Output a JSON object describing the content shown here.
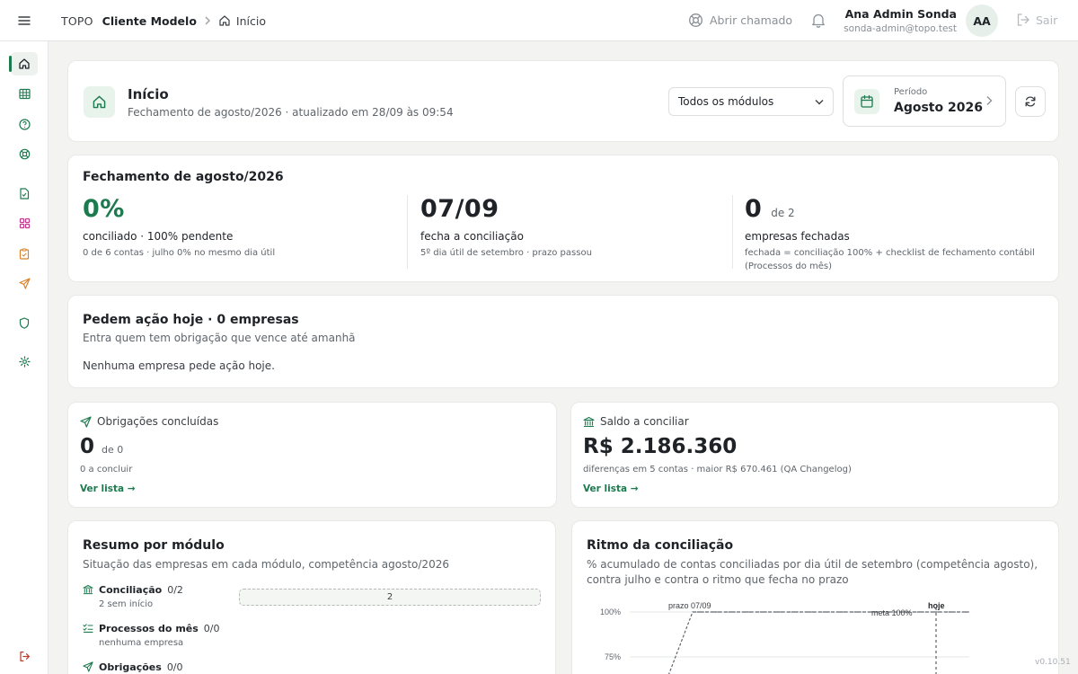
{
  "topbar": {
    "brand": "TOPO",
    "client": "Cliente Modelo",
    "breadcrumb_current": "Início",
    "open_ticket": "Abrir chamado",
    "user_name": "Ana Admin Sonda",
    "user_email": "sonda-admin@topo.test",
    "avatar_initials": "AA",
    "logout": "Sair"
  },
  "sidebar": {
    "items": [
      {
        "icon": "home-icon",
        "active": true
      },
      {
        "icon": "table-icon"
      },
      {
        "icon": "help-icon"
      },
      {
        "icon": "lifebuoy-icon"
      },
      {
        "icon": "document-icon"
      },
      {
        "icon": "apps-icon"
      },
      {
        "icon": "clipboard-icon"
      },
      {
        "icon": "send-icon"
      },
      {
        "icon": "shield-icon"
      },
      {
        "icon": "settings-icon"
      },
      {
        "icon": "logout-icon"
      }
    ]
  },
  "header": {
    "title": "Início",
    "subtitle": "Fechamento de agosto/2026 · atualizado em 28/09 às 09:54",
    "module_select": "Todos os módulos",
    "period_label": "Período",
    "period_value": "Agosto 2026"
  },
  "closing": {
    "title": "Fechamento de agosto/2026",
    "kpis": [
      {
        "big": "0%",
        "small": "",
        "label": "conciliado · 100% pendente",
        "sub": "0 de 6 contas · julho 0% no mesmo dia útil"
      },
      {
        "big": "07/09",
        "small": "",
        "label": "fecha a conciliação",
        "sub": "5º dia útil de setembro · prazo passou"
      },
      {
        "big": "0",
        "small": "de 2",
        "label": "empresas fechadas",
        "sub": "fechada = conciliação 100% + checklist de fechamento contábil (Processos do mês)"
      }
    ]
  },
  "action": {
    "title": "Pedem ação hoje · 0 empresas",
    "subtitle": "Entra quem tem obrigação que vence até amanhã",
    "empty": "Nenhuma empresa pede ação hoje."
  },
  "obligations": {
    "title": "Obrigações concluídas",
    "big": "0",
    "small": "de 0",
    "sub": "0 a concluir",
    "link": "Ver lista →"
  },
  "balance": {
    "title": "Saldo a conciliar",
    "big": "R$ 2.186.360",
    "sub": "diferenças em 5 contas · maior R$ 670.461 (QA Changelog)",
    "link": "Ver lista →"
  },
  "summary": {
    "title": "Resumo por módulo",
    "subtitle": "Situação das empresas em cada módulo, competência agosto/2026",
    "modules": [
      {
        "name": "Conciliação",
        "count": "0/2",
        "sub": "2 sem início",
        "bar_label": "2"
      },
      {
        "name": "Processos do mês",
        "count": "0/0",
        "sub": "nenhuma empresa"
      },
      {
        "name": "Obrigações",
        "count": "0/0"
      }
    ]
  },
  "rhythm": {
    "title": "Ritmo da conciliação",
    "subtitle": "% acumulado de contas conciliadas por dia útil de setembro (competência agosto), contra julho e contra o ritmo que fecha no prazo",
    "deadline_label": "prazo 07/09",
    "goal_label": "meta 100%",
    "today_label": "hoje",
    "y_ticks": [
      "100%",
      "75%"
    ]
  },
  "chart_data": {
    "type": "line",
    "title": "Ritmo da conciliação",
    "ylabel": "",
    "xlabel": "",
    "y_ticks": [
      "100%",
      "75%"
    ],
    "ylim": [
      0,
      100
    ],
    "annotations": [
      "prazo 07/09",
      "meta 100%",
      "hoje"
    ],
    "series": [
      {
        "values": [
          0,
          100,
          100
        ]
      }
    ]
  },
  "version": "v0.10.51"
}
